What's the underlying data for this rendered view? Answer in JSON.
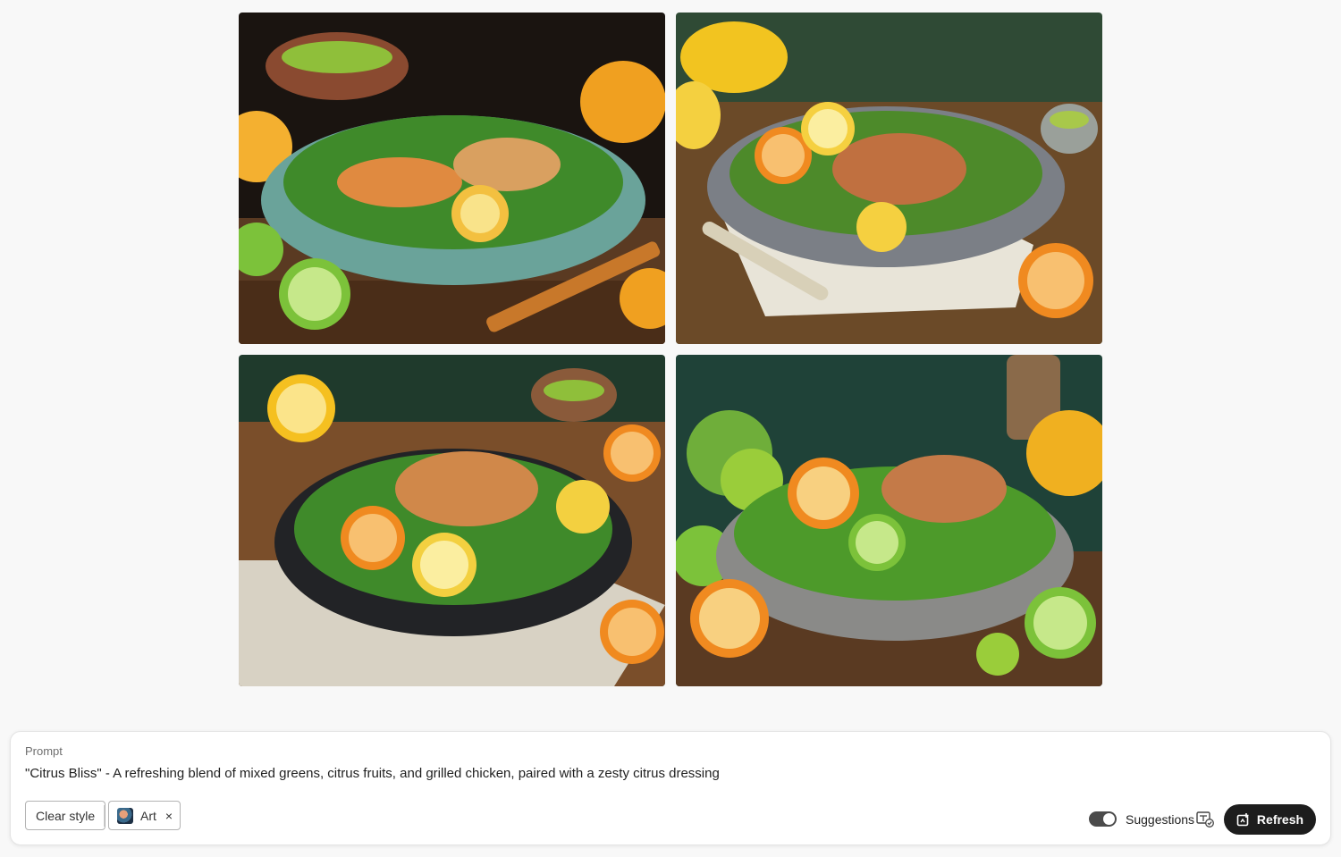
{
  "gallery": {
    "images": [
      {
        "icon": "grilled-chicken-citrus-salad-image-1"
      },
      {
        "icon": "grilled-chicken-citrus-salad-image-2"
      },
      {
        "icon": "grilled-chicken-citrus-salad-image-3"
      },
      {
        "icon": "grilled-chicken-citrus-salad-image-4"
      }
    ]
  },
  "prompt": {
    "label": "Prompt",
    "value": "\"Citrus Bliss\" - A refreshing blend of mixed greens, citrus fruits, and grilled chicken, paired with a zesty citrus dressing"
  },
  "styles": {
    "clear_label": "Clear style",
    "chip_label": "Art",
    "chip_close": "×"
  },
  "controls": {
    "suggestions_label": "Suggestions",
    "suggestions_on": true,
    "refresh_label": "Refresh"
  },
  "colors": {
    "primary_button": "#1d1d1d",
    "toggle_on": "#4b4b4b"
  }
}
